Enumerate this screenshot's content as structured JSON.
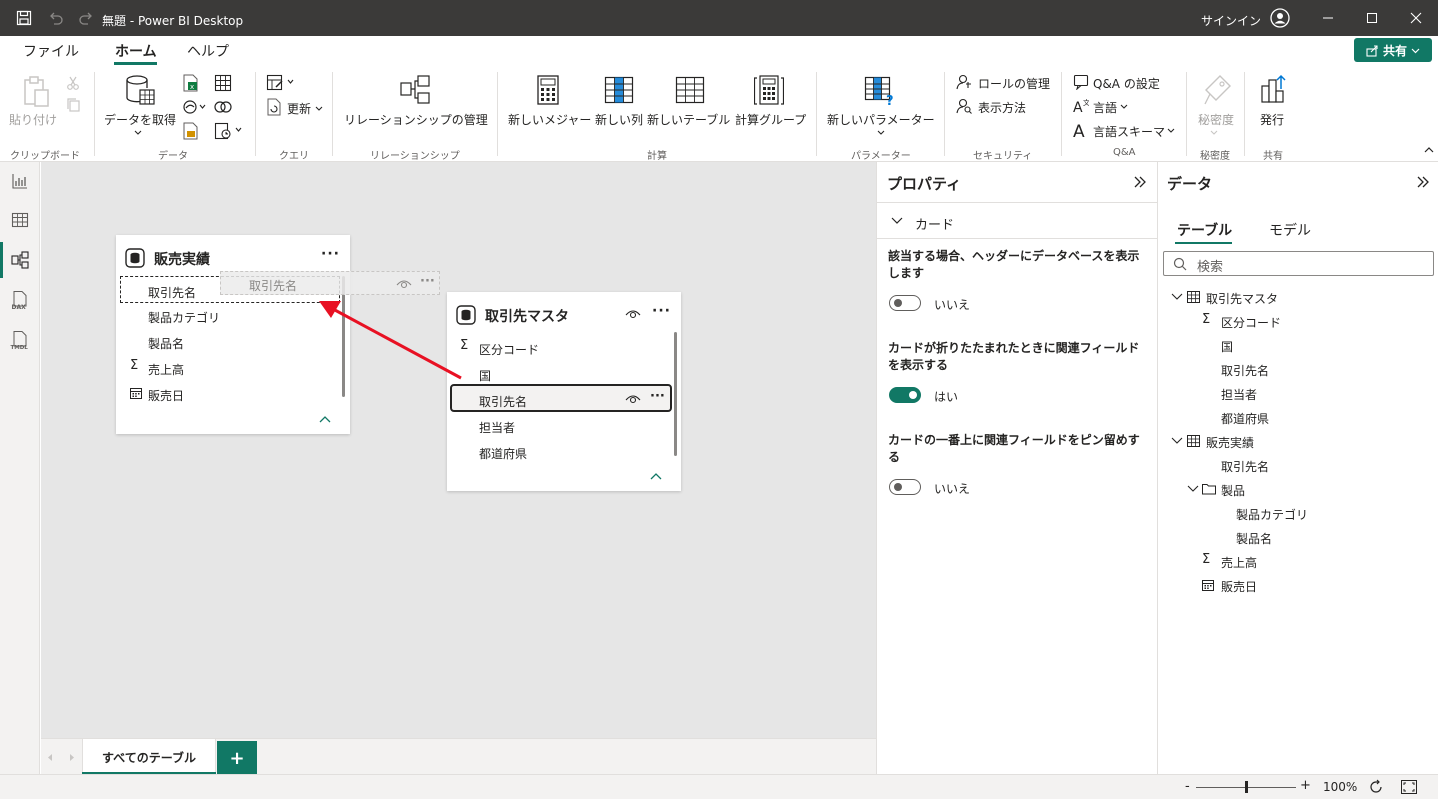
{
  "window": {
    "title": "無題 - Power BI Desktop",
    "sign_in": "サインイン"
  },
  "menu": {
    "tabs": [
      "ファイル",
      "ホーム",
      "ヘルプ"
    ],
    "active": "ホーム",
    "share_label": "共有"
  },
  "ribbon": {
    "paste": "貼り付け",
    "get_data": "データを取得",
    "refresh": "更新",
    "manage_relationships": "リレーションシップの管理",
    "new_measure": "新しいメジャー",
    "new_column": "新しい列",
    "new_table": "新しいテーブル",
    "calc_group": "計算グループ",
    "new_parameter": "新しいパラメーター",
    "manage_roles": "ロールの管理",
    "view_as": "表示方法",
    "qa_setup": "Q&A の設定",
    "language": "言語",
    "linguistic_schema": "言語スキーマ",
    "sensitivity": "秘密度",
    "publish": "発行",
    "groups": {
      "clipboard": "クリップボード",
      "data": "データ",
      "queries": "クエリ",
      "relationships": "リレーションシップ",
      "calculations": "計算",
      "parameters": "パラメーター",
      "security": "セキュリティ",
      "qa": "Q&A",
      "sensitivity": "秘密度",
      "share": "共有"
    }
  },
  "canvas": {
    "table1": {
      "name": "販売実績",
      "fields": [
        "取引先名",
        "製品カテゴリ",
        "製品名",
        "売上高",
        "販売日"
      ]
    },
    "drag_ghost": "取引先名",
    "table2": {
      "name": "取引先マスタ",
      "fields": [
        "区分コード",
        "国",
        "取引先名",
        "担当者",
        "都道府県"
      ]
    },
    "layout_tab": "すべてのテーブル",
    "add_tab": "+"
  },
  "properties": {
    "title": "プロパティ",
    "section": "カード",
    "settings": [
      {
        "text": "該当する場合、ヘッダーにデータベースを表示します",
        "value": "いいえ",
        "on": false
      },
      {
        "text": "カードが折りたたまれたときに関連フィールドを表示する",
        "value": "はい",
        "on": true
      },
      {
        "text": "カードの一番上に関連フィールドをピン留めする",
        "value": "いいえ",
        "on": false
      }
    ]
  },
  "data_pane": {
    "title": "データ",
    "tabs": [
      "テーブル",
      "モデル"
    ],
    "search_placeholder": "検索",
    "tree": {
      "t1": "取引先マスタ",
      "t1_fields": [
        "区分コード",
        "国",
        "取引先名",
        "担当者",
        "都道府県"
      ],
      "t2": "販売実績",
      "t2_field1": "取引先名",
      "folder": "製品",
      "folder_fields": [
        "製品カテゴリ",
        "製品名"
      ],
      "t2_field2": "売上高",
      "t2_field3": "販売日"
    }
  },
  "status": {
    "zoom": "100%",
    "zoom_level": 0.5
  },
  "colors": {
    "accent": "#117865",
    "arrow": "#e81123",
    "titlebar": "#3b3a39"
  }
}
